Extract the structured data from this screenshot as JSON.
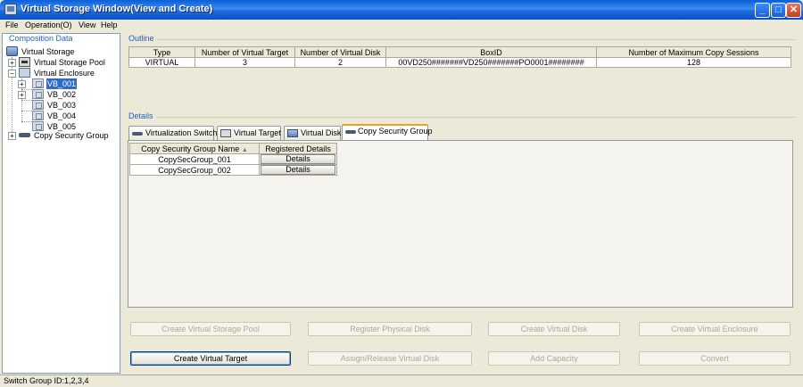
{
  "window": {
    "title": "Virtual Storage Window(View and Create)",
    "min_glyph": "_",
    "max_glyph": "□",
    "close_glyph": "✕"
  },
  "menu": {
    "file": "File",
    "operation": "Operation(O)",
    "view": "View",
    "help": "Help"
  },
  "tree": {
    "heading": "Composition Data",
    "root": "Virtual Storage",
    "pool": "Virtual Storage Pool",
    "enclosure": "Virtual Enclosure",
    "vbs": [
      "VB_001",
      "VB_002",
      "VB_003",
      "VB_004",
      "VB_005"
    ],
    "selected": "VB_001",
    "copy_group": "Copy Security Group"
  },
  "outline": {
    "heading": "Outline",
    "columns": [
      "Type",
      "Number of Virtual Target",
      "Number of Virtual Disk",
      "BoxID",
      "Number of Maximum Copy Sessions"
    ],
    "row": [
      "VIRTUAL",
      "3",
      "2",
      "00VD250#######VD250#######PO0001########",
      "128"
    ]
  },
  "details": {
    "heading": "Details",
    "tabs": [
      "Virtualization Switch",
      "Virtual Target",
      "Virtual Disk",
      "Copy Security Group"
    ],
    "active_tab": "Copy Security Group",
    "table": {
      "columns": [
        "Copy Security Group Name",
        "Registered Details"
      ],
      "sort_glyph": "▲",
      "rows": [
        {
          "name": "CopySecGroup_001",
          "action": "Details"
        },
        {
          "name": "CopySecGroup_002",
          "action": "Details"
        }
      ]
    }
  },
  "buttons": {
    "create_pool": "Create Virtual Storage Pool",
    "register_disk": "Register Physical Disk",
    "create_disk": "Create Virtual Disk",
    "create_enclosure": "Create Virtual Enclosure",
    "create_target": "Create Virtual Target",
    "assign_release": "Assign/Release Virtual Disk",
    "add_capacity": "Add Capacity",
    "convert": "Convert"
  },
  "status": {
    "text": "Switch Group ID:1,2,3,4"
  }
}
